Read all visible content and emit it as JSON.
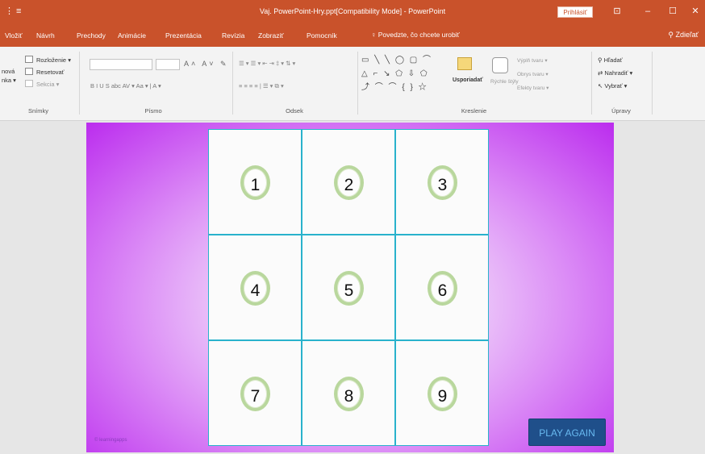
{
  "titlebar": {
    "quick_access": "⋮ ≡",
    "title": "Vaj. PowerPoint-Hry.ppt[Compatibility Mode] - PowerPoint",
    "signin": "Prihlásiť",
    "ribbon_display_icon": "ribbon-display-icon",
    "min_label": "–",
    "max_label": "☐",
    "close_label": "✕"
  },
  "tabs": [
    "Vložiť",
    "Návrh",
    "Prechody",
    "Animácie",
    "Prezentácia",
    "Revízia",
    "Zobraziť",
    "Pomocník"
  ],
  "tell_me": "Povedzte, čo chcete urobiť",
  "share": "Zdieľať",
  "ribbon": {
    "slides_group": {
      "label": "Snímky",
      "items": [
        "Rozloženie ▾",
        "Resetovať",
        "Sekcia ▾"
      ],
      "partial_left": [
        "nová",
        "nka ▾"
      ]
    },
    "font_group": {
      "label": "Písmo",
      "format_row": "B  I  U  S  abc  AV ▾  Aa ▾  |  A ▾"
    },
    "paragraph_group": {
      "label": "Odsek",
      "row1": "☰ ▾  ☰ ▾  ⇤  ⇥  ‡ ▾  ⇅ ▾",
      "row2": "≡  ≡  ≡  ≡  |  ☰ ▾  ⧉ ▾"
    },
    "drawing_group": {
      "label": "Kreslenie",
      "arrange": "Usporiadať",
      "quick_styles": "Rýchle štýly",
      "fill": "Výplň tvaru ▾",
      "outline": "Obrys tvaru ▾",
      "effects": "Efekty tvaru ▾"
    },
    "editing_group": {
      "label": "Úpravy",
      "find": "Hľadať",
      "replace": "Nahradiť ▾",
      "select": "Vybrať ▾"
    }
  },
  "slide": {
    "numbers": [
      "1",
      "2",
      "3",
      "4",
      "5",
      "6",
      "7",
      "8",
      "9"
    ],
    "play_again": "PLAY AGAIN",
    "watermark": "© learningapps"
  }
}
